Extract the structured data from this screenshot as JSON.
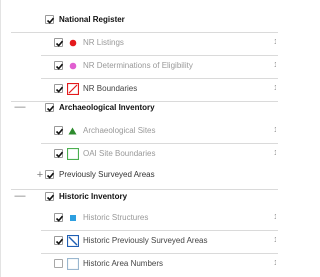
{
  "groups": [
    {
      "label": "National Register",
      "collapse_symbol": "—",
      "checked": true,
      "layers": [
        {
          "label": "NR Listings",
          "symbol": "red-dot-icon",
          "color": "#e41a1c",
          "muted": true,
          "checked": true,
          "right": "1"
        },
        {
          "label": "NR Determinations of Eligibility",
          "symbol": "pink-dot-icon",
          "color": "#e05fd0",
          "muted": true,
          "checked": true,
          "right": "1"
        },
        {
          "label": "NR Boundaries",
          "symbol": "red-hatch-box-icon",
          "color": "#e41a1c",
          "muted": false,
          "checked": true,
          "right": "1"
        }
      ]
    },
    {
      "label": "Archaeological Inventory",
      "collapse_symbol": "—",
      "checked": true,
      "layers": [
        {
          "label": "Archaeological Sites",
          "symbol": "green-triangle-icon",
          "color": "#2e8b2e",
          "muted": true,
          "checked": true,
          "right": "1"
        },
        {
          "label": "OAI Site Boundaries",
          "symbol": "green-box-icon",
          "color": "#4caf50",
          "muted": true,
          "checked": true,
          "right": "1"
        }
      ]
    },
    {
      "label": "Previously Surveyed Areas",
      "collapse_symbol": "+",
      "checked": true,
      "layers": []
    },
    {
      "label": "Historic Inventory",
      "collapse_symbol": "—",
      "checked": true,
      "layers": [
        {
          "label": "Historic Structures",
          "symbol": "blue-square-icon",
          "color": "#2d9fe0",
          "muted": true,
          "checked": true,
          "right": "1"
        },
        {
          "label": "Historic Previously Surveyed Areas",
          "symbol": "blue-hatch-box-icon",
          "color": "#1f5fb4",
          "muted": true,
          "checked": true,
          "right": "1"
        },
        {
          "label": "Historic Area Numbers",
          "symbol": "empty-box-icon",
          "color": "#9ab7cf",
          "muted": false,
          "checked": false,
          "right": "1"
        }
      ]
    }
  ]
}
